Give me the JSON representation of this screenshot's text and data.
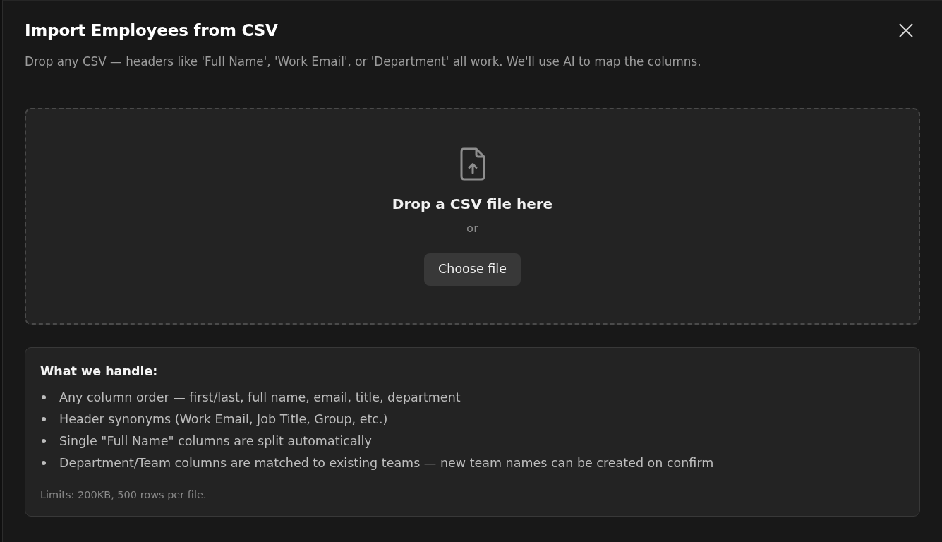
{
  "dialog": {
    "title": "Import Employees from CSV",
    "subtitle": "Drop any CSV — headers like 'Full Name', 'Work Email', or 'Department' all work. We'll use AI to map the columns."
  },
  "dropzone": {
    "heading": "Drop a CSV file here",
    "separator": "or",
    "button": "Choose file"
  },
  "info": {
    "heading": "What we handle:",
    "items": [
      "Any column order — first/last, full name, email, title, department",
      "Header synonyms (Work Email, Job Title, Group, etc.)",
      "Single \"Full Name\" columns are split automatically",
      "Department/Team columns are matched to existing teams — new team names can be created on confirm"
    ],
    "note": "Limits: 200KB, 500 rows per file."
  }
}
